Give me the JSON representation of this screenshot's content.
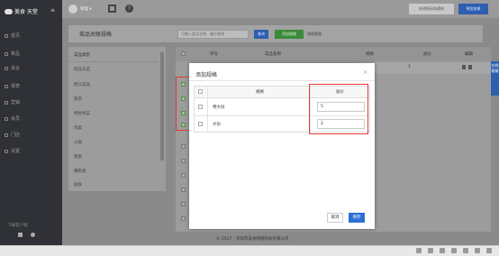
{
  "sidebar": {
    "brand": "美食 天堂",
    "nav": [
      "首页",
      "菜品",
      "桌台",
      "报表",
      "营销",
      "会员",
      "门店",
      "设置"
    ],
    "download_label": "下载客户端"
  },
  "topbar": {
    "user": "管理 ▾",
    "notice_button": "修改密码和通知",
    "preview_button": "预览效果"
  },
  "page": {
    "title": "菜品关联规格",
    "search_placeholder": "可输入菜品名称、编号查询",
    "search_button": "查询",
    "add_spec_button": "添加规格",
    "spec_manage_link": "规格管理"
  },
  "categories": {
    "header": "菜品类别",
    "items": [
      "招品天菜",
      "默认菜品",
      "家常",
      "特色特菜",
      "肉类",
      "火锅",
      "煲类",
      "腌制类",
      "副食"
    ]
  },
  "main_table": {
    "columns": [
      "序号",
      "菜品名称",
      "规格",
      "加价",
      "编辑"
    ],
    "row_number": "1"
  },
  "side_tab": "在线客服",
  "footer": "© 2017 - 深圳市美食网络科技有限公司",
  "modal": {
    "title": "添加规格",
    "close": "×",
    "headers": {
      "spec": "规格",
      "price": "加价"
    },
    "rows": [
      {
        "spec": "特大份",
        "price": "5"
      },
      {
        "spec": "大份",
        "price": "2"
      }
    ],
    "cancel_button": "取消",
    "save_button": "保存"
  }
}
